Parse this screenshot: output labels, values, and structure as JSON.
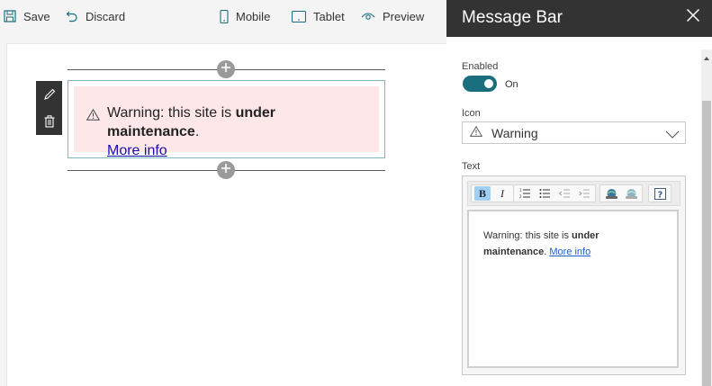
{
  "toolbar": {
    "save_label": "Save",
    "discard_label": "Discard",
    "mobile_label": "Mobile",
    "tablet_label": "Tablet",
    "preview_label": "Preview"
  },
  "message_bar": {
    "text_prefix": "Warning: this site is ",
    "text_bold": "under maintenance",
    "text_suffix": ".",
    "link_text": "More info"
  },
  "panel": {
    "title": "Message Bar",
    "enabled_label": "Enabled",
    "toggle_state": "On",
    "icon_label": "Icon",
    "icon_value": "Warning",
    "text_label": "Text"
  },
  "editor": {
    "text_prefix": "Warning: this site is ",
    "text_bold": "under maintenance",
    "text_suffix": ". ",
    "link_text": "More info",
    "tools": [
      "bold-icon",
      "italic-icon",
      "numbered-list-icon",
      "bullet-list-icon",
      "decrease-indent-icon",
      "increase-indent-icon",
      "insert-link-icon",
      "remove-link-icon",
      "help-icon"
    ]
  },
  "colors": {
    "header_bg": "#333333",
    "toggle_on": "#1a6e7e",
    "message_bg": "#fde7e9",
    "webpart_border": "#7bb8bd",
    "link": "#1a0dab"
  }
}
